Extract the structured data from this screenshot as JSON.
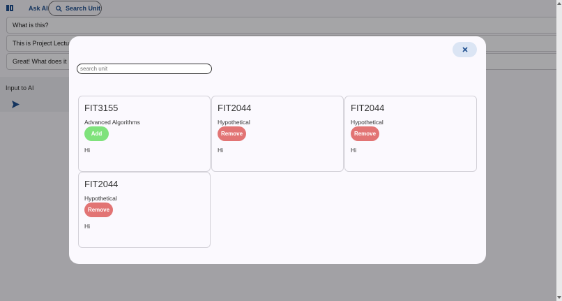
{
  "topbar": {
    "sidebar_icon": "sidebar-toggle-icon",
    "ask_ai_label": "Ask AI",
    "search_unit_label": "Search Unit"
  },
  "chat": {
    "messages": [
      "What is this?",
      "This is Project Lectu",
      "Great! What does it"
    ],
    "input_label": "Input to AI"
  },
  "modal": {
    "close_icon": "close-icon",
    "search": {
      "placeholder": "search unit",
      "value": ""
    },
    "cards": [
      {
        "code": "FIT3155",
        "name": "Advanced Algorithms",
        "button": "Add",
        "description": "Hi"
      },
      {
        "code": "FIT2044",
        "name": "Hypothetical",
        "button": "Remove",
        "description": "Hi"
      },
      {
        "code": "FIT2044",
        "name": "Hypothetical",
        "button": "Remove",
        "description": "Hi"
      },
      {
        "code": "FIT2044",
        "name": "Hypothetical",
        "button": "Remove",
        "description": "Hi"
      }
    ]
  },
  "colors": {
    "accent": "#1f4f8f",
    "add": "#7fe27c",
    "remove": "#e27474",
    "close_bg": "#dbe5f4"
  }
}
